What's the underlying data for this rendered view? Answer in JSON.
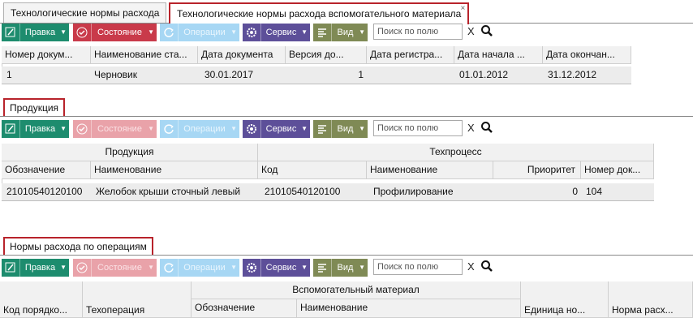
{
  "tabs": [
    {
      "label": "Технологические нормы расхода"
    },
    {
      "label": "Технологические нормы расхода вспомогательного материала",
      "close": "×"
    }
  ],
  "toolbar": {
    "edit": "Правка",
    "status": "Состояние",
    "operations": "Операции",
    "service": "Сервис",
    "view": "Вид",
    "search_placeholder": "Поиск по полю",
    "clear": "X"
  },
  "grid1": {
    "headers": [
      "Номер докум...",
      "Наименование ста...",
      "Дата документа",
      "Версия до...",
      "Дата регистра...",
      "Дата начала ...",
      "Дата окончан..."
    ],
    "row": [
      "1",
      "Черновик",
      "30.01.2017",
      "1",
      "",
      "01.01.2012",
      "31.12.2012"
    ]
  },
  "section2": {
    "tab": "Продукция",
    "group_headers": [
      "Продукция",
      "Техпроцесс"
    ],
    "headers": [
      "Обозначение",
      "Наименование",
      "Код",
      "Наименование",
      "Приоритет",
      "Номер док..."
    ],
    "row": [
      "21010540120100",
      "Желобок крыши сточный левый",
      "21010540120100",
      "Профилирование",
      "0",
      "104"
    ]
  },
  "section3": {
    "tab": "Нормы расхода по операциям",
    "group_header": "Вспомогательный материал",
    "headers": [
      "Код порядко...",
      "Техоперация",
      "Обозначение",
      "Наименование",
      "Единица но...",
      "Норма расх..."
    ]
  },
  "colors": {
    "accent_red": "#b8232b",
    "green": "#1d8c6e",
    "red": "#c93a4a",
    "blue": "#2c9ee0",
    "purple": "#5d4f99",
    "olive": "#7f8a55"
  }
}
